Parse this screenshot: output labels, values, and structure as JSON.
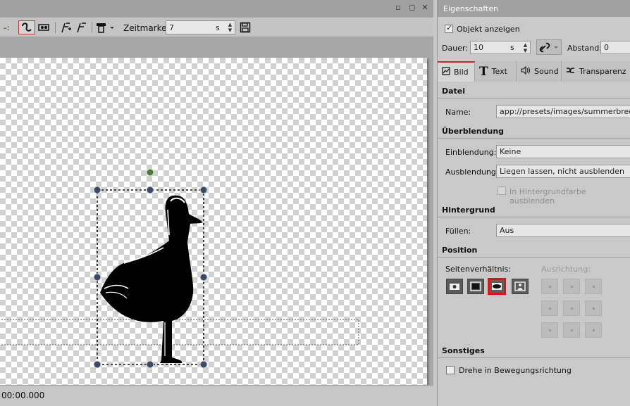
{
  "left_pane": {
    "window_buttons": [
      "▫",
      "◻",
      "✕"
    ],
    "toolbar": {
      "dropdown_stub": "–:",
      "zeitmarke_label": "Zeitmarke:",
      "zeitmarke_value": "7",
      "zeitmarke_unit": "s"
    },
    "status": {
      "timecode": "00:00.000"
    }
  },
  "properties": {
    "title": "Eigenschaften",
    "objekt_anzeigen": {
      "label": "Objekt anzeigen",
      "checked": true
    },
    "dauer": {
      "label": "Dauer:",
      "value": "10",
      "unit": "s"
    },
    "abstand": {
      "label": "Abstand:",
      "value": "0"
    },
    "tabs": [
      {
        "label": "Bild",
        "icon": "image-icon",
        "active": true
      },
      {
        "label": "Text",
        "icon": "text-icon",
        "active": false
      },
      {
        "label": "Sound",
        "icon": "speaker-icon",
        "active": false
      },
      {
        "label": "Transparenz",
        "icon": "transparency-icon",
        "active": false
      }
    ],
    "datei": {
      "heading": "Datei",
      "name_label": "Name:",
      "name_value": "app://presets/images/summerbreeze/se"
    },
    "ueberblendung": {
      "heading": "Überblendung",
      "einblendung_label": "Einblendung:",
      "einblendung_value": "Keine",
      "ausblendung_label": "Ausblendung:",
      "ausblendung_value": "Liegen lassen, nicht ausblenden",
      "hintergrund_checkbox": "In Hintergrundfarbe ausblenden"
    },
    "hintergrund": {
      "heading": "Hintergrund",
      "fuellen_label": "Füllen:",
      "fuellen_value": "Aus"
    },
    "position": {
      "heading": "Position",
      "seitenverhaeltnis_label": "Seitenverhältnis:",
      "ausrichtung_label": "Ausrichtung:",
      "selected_aspect_index": 2
    },
    "sonstiges": {
      "heading": "Sonstiges",
      "drehe_label": "Drehe in Bewegungsrichtung",
      "drehe_checked": false
    }
  },
  "colors": {
    "accent_red": "#e1111a",
    "rotation_handle": "#4c7a3a",
    "handle_fill": "#3d4a66"
  }
}
